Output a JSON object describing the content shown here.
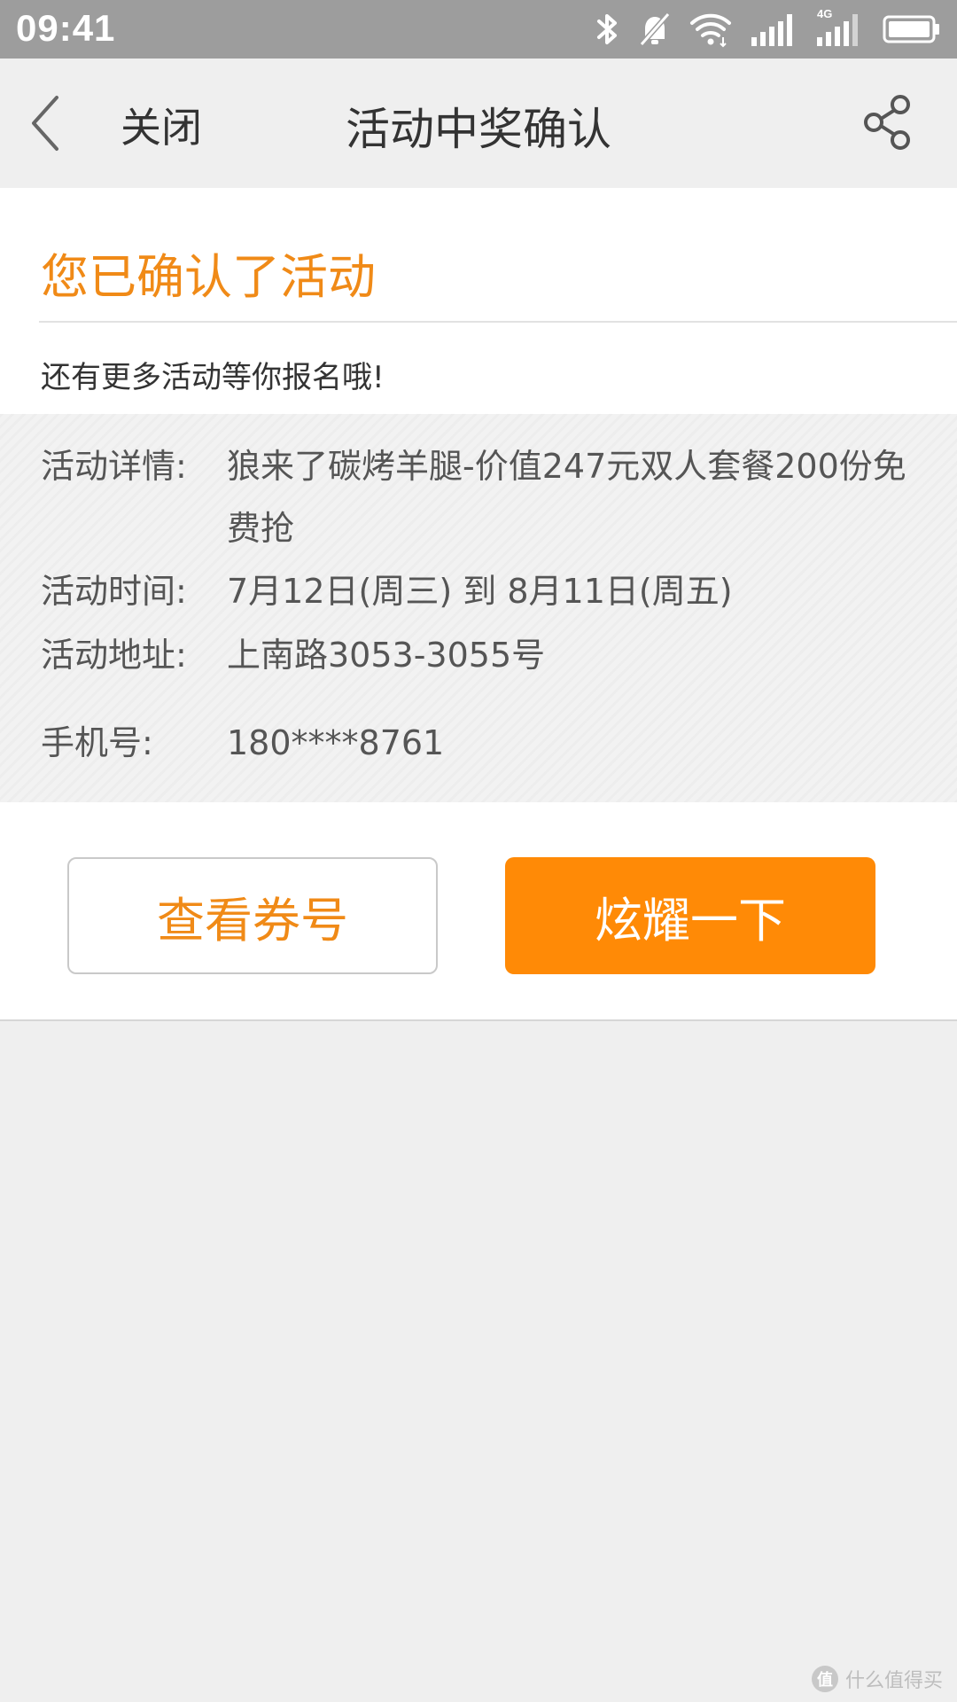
{
  "status_bar": {
    "time": "09:41",
    "icons": [
      "bluetooth-icon",
      "silent-icon",
      "wifi-icon",
      "signal-icon",
      "4g-signal-icon",
      "battery-icon"
    ],
    "network_label": "4G"
  },
  "nav": {
    "back_icon": "chevron-left-icon",
    "close_label": "关闭",
    "title": "活动中奖确认",
    "share_icon": "share-icon"
  },
  "card": {
    "confirm_title": "您已确认了活动",
    "more_text": "还有更多活动等你报名哦!",
    "details": [
      {
        "label": "活动详情:",
        "value": "狼来了碳烤羊腿-价值247元双人套餐200份免费抢"
      },
      {
        "label": "活动时间:",
        "value": "7月12日(周三) 到 8月11日(周五)"
      },
      {
        "label": "活动地址:",
        "value": "上南路3053-3055号"
      },
      {
        "label": "手机号:",
        "value": "180****8761"
      }
    ],
    "buttons": {
      "view_coupon": "查看券号",
      "show_off": "炫耀一下"
    }
  },
  "watermark": {
    "logo_text": "值",
    "text": "什么值得买"
  },
  "colors": {
    "accent": "#f08a17",
    "primary_button": "#ff8a06",
    "status_bar": "#9d9d9d",
    "background": "#efefef"
  }
}
